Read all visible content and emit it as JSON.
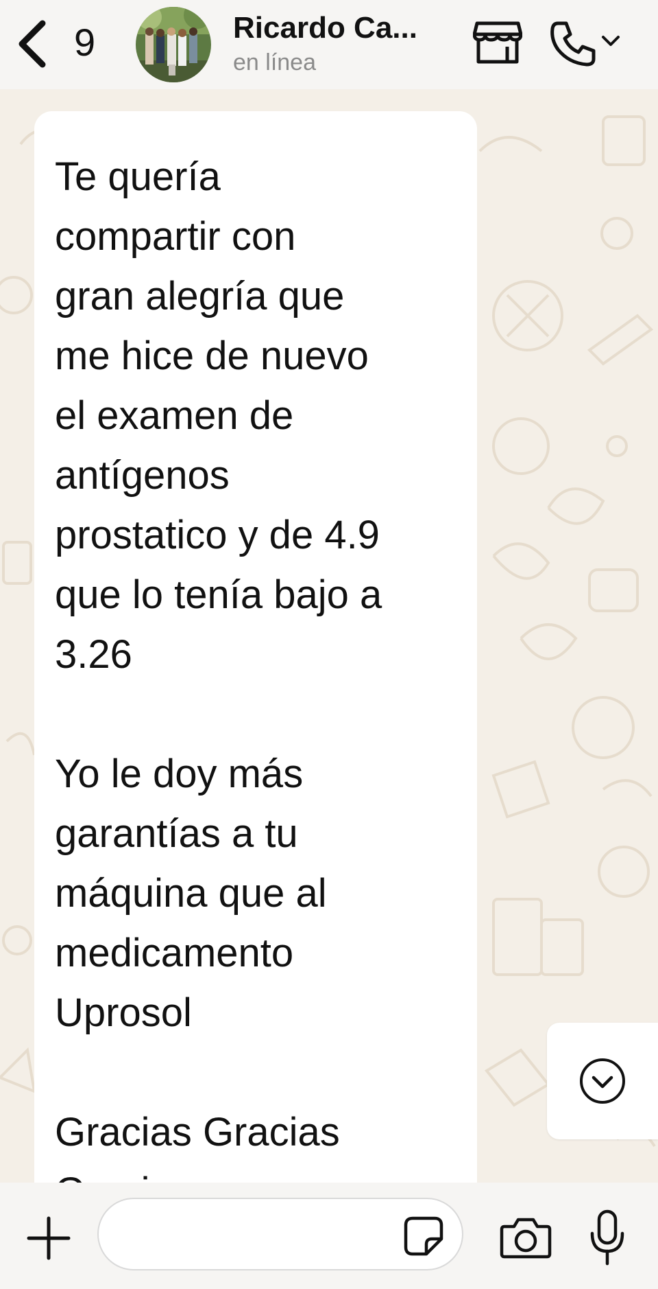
{
  "header": {
    "unread_count": "9",
    "contact_name": "Ricardo Ca...",
    "status": "en línea",
    "icons": {
      "back": "chevron-left-icon",
      "store": "storefront-icon",
      "call": "phone-icon",
      "call_menu": "chevron-down-icon"
    }
  },
  "chat": {
    "message": {
      "paragraph1": "Te quería\ncompartir con\ngran alegría que\nme hice de nuevo\nel examen de\nantígenos\nprostatico y de 4.9\nque lo tenía bajo a\n3.26",
      "paragraph2": "Yo le doy más\ngarantías a tu\nmáquina que al\nmedicamento\nUprosol",
      "paragraph3": "Gracias Gracias\nGracias"
    },
    "scroll_button_icon": "chevron-down-circle-icon"
  },
  "composer": {
    "input_value": "",
    "icons": {
      "attach": "plus-icon",
      "sticker": "sticker-icon",
      "camera": "camera-icon",
      "voice": "microphone-icon"
    }
  },
  "colors": {
    "background": "#f4efe7",
    "bubble": "#ffffff",
    "header": "#f6f5f3",
    "text": "#111111",
    "muted": "#8a8a8a"
  }
}
